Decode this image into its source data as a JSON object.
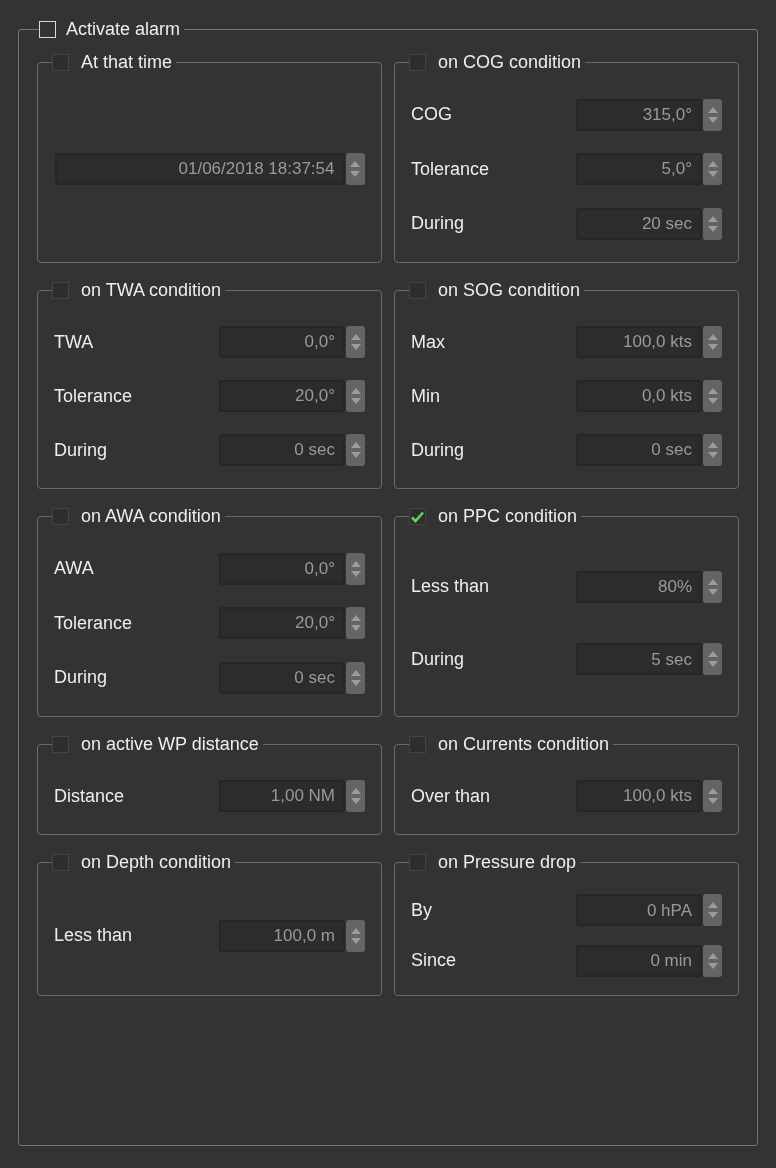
{
  "alarm": {
    "label": "Activate alarm",
    "checked": false,
    "groups": [
      {
        "title": "At that time",
        "checked": false,
        "fields": [
          {
            "value": "01/06/2018 18:37:54"
          }
        ]
      },
      {
        "title": "on COG condition",
        "checked": false,
        "fields": [
          {
            "label": "COG",
            "value": "315,0°"
          },
          {
            "label": "Tolerance",
            "value": "5,0°"
          },
          {
            "label": "During",
            "value": "20 sec"
          }
        ]
      },
      {
        "title": "on TWA condition",
        "checked": false,
        "fields": [
          {
            "label": "TWA",
            "value": "0,0°"
          },
          {
            "label": "Tolerance",
            "value": "20,0°"
          },
          {
            "label": "During",
            "value": "0 sec"
          }
        ]
      },
      {
        "title": "on SOG condition",
        "checked": false,
        "fields": [
          {
            "label": "Max",
            "value": "100,0 kts"
          },
          {
            "label": "Min",
            "value": "0,0 kts"
          },
          {
            "label": "During",
            "value": "0 sec"
          }
        ]
      },
      {
        "title": "on AWA condition",
        "checked": false,
        "fields": [
          {
            "label": "AWA",
            "value": "0,0°"
          },
          {
            "label": "Tolerance",
            "value": "20,0°"
          },
          {
            "label": "During",
            "value": "0 sec"
          }
        ]
      },
      {
        "title": "on PPC condition",
        "checked": true,
        "fields": [
          {
            "label": "Less than",
            "value": "80%"
          },
          {
            "label": "During",
            "value": "5 sec"
          }
        ]
      },
      {
        "title": "on active WP distance",
        "checked": false,
        "fields": [
          {
            "label": "Distance",
            "value": "1,00 NM"
          }
        ]
      },
      {
        "title": "on Currents condition",
        "checked": false,
        "fields": [
          {
            "label": "Over than",
            "value": "100,0 kts"
          }
        ]
      },
      {
        "title": "on Depth condition",
        "checked": false,
        "fields": [
          {
            "label": "Less than",
            "value": "100,0 m"
          }
        ]
      },
      {
        "title": "on Pressure drop",
        "checked": false,
        "fields": [
          {
            "label": "By",
            "value": "0 hPA"
          },
          {
            "label": "Since",
            "value": "0 min"
          }
        ]
      }
    ]
  }
}
